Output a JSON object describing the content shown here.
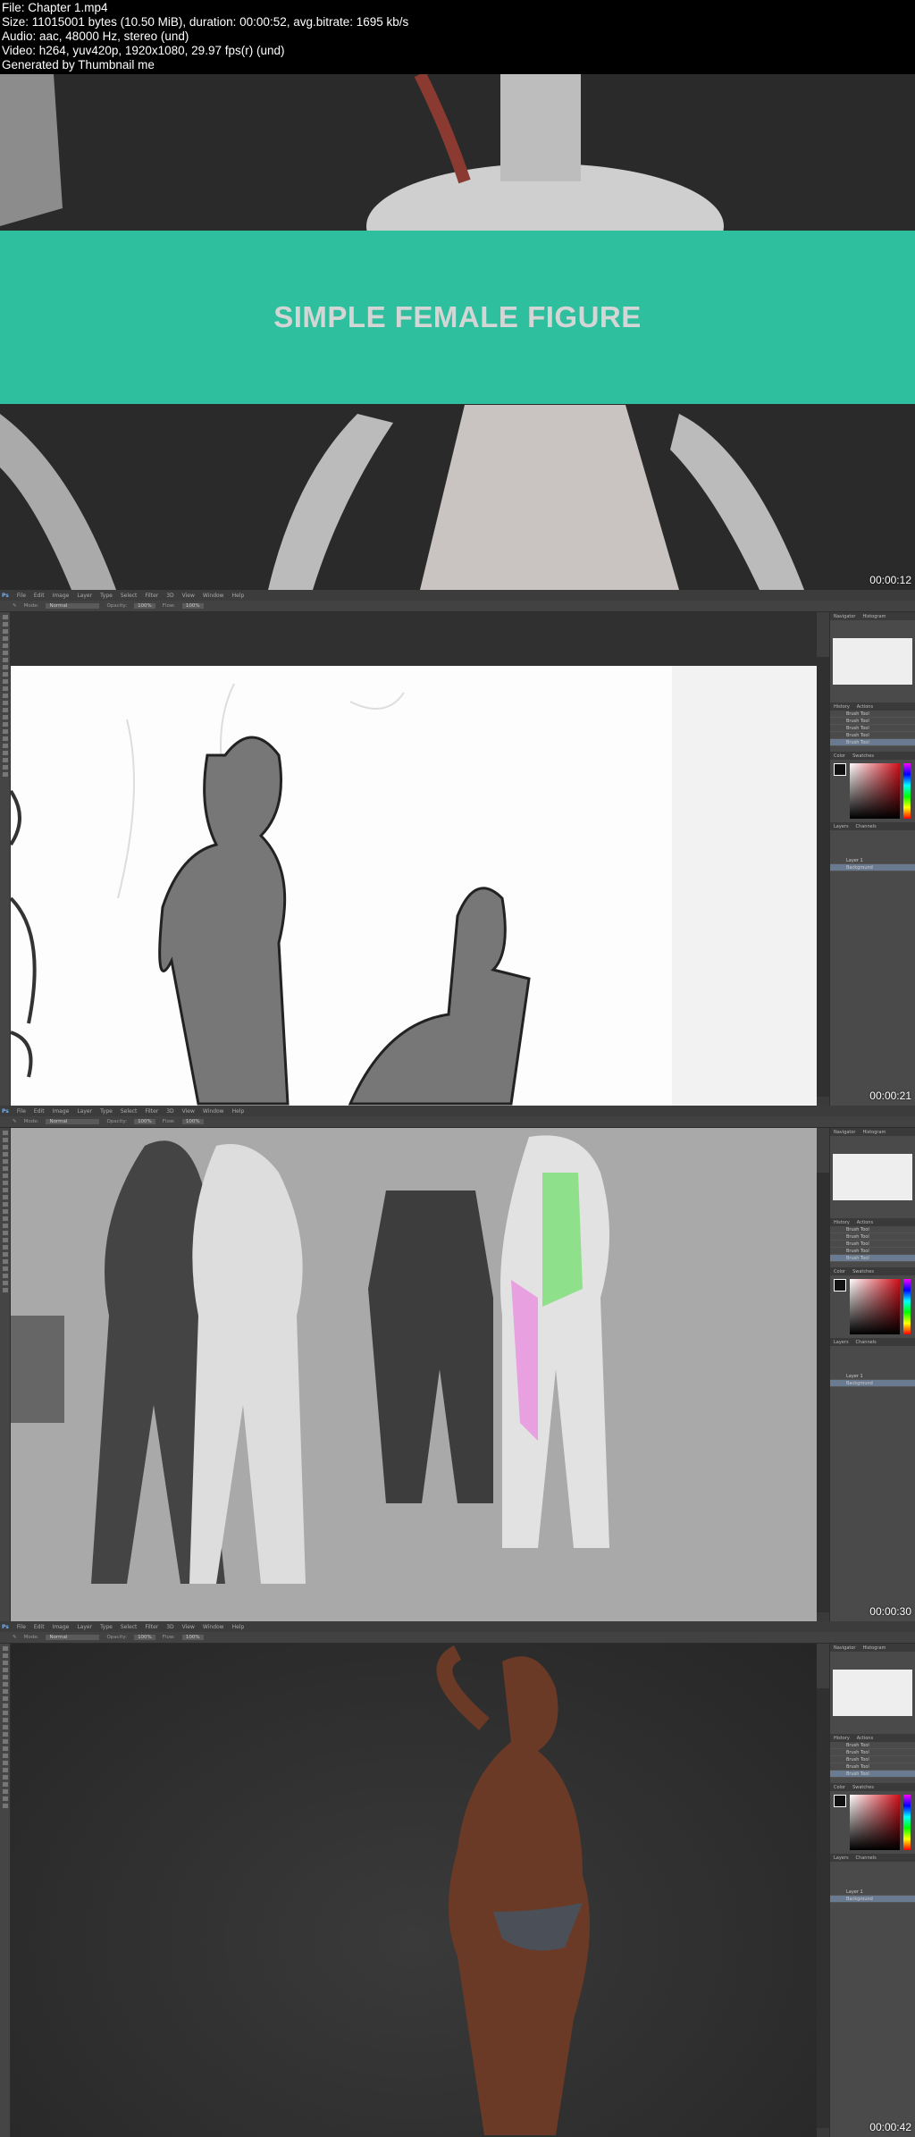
{
  "info": {
    "lines": [
      "File: Chapter 1.mp4",
      "Size: 11015001 bytes (10.50 MiB), duration: 00:00:52, avg.bitrate: 1695 kb/s",
      "Audio: aac, 48000 Hz, stereo (und)",
      "Video: h264, yuv420p, 1920x1080, 29.97 fps(r) (und)",
      "Generated by Thumbnail me"
    ]
  },
  "frames": [
    {
      "timestamp": "00:00:12",
      "title": "SIMPLE FEMALE FIGURE"
    },
    {
      "timestamp": "00:00:21"
    },
    {
      "timestamp": "00:00:30"
    },
    {
      "timestamp": "00:00:42"
    }
  ],
  "ps": {
    "logo": "Ps",
    "menu": [
      "File",
      "Edit",
      "Image",
      "Layer",
      "Type",
      "Select",
      "Filter",
      "3D",
      "View",
      "Window",
      "Help"
    ],
    "options": {
      "mode_label": "Mode:",
      "mode": "Normal",
      "opacity_label": "Opacity:",
      "opacity": "100%",
      "flow_label": "Flow:",
      "flow": "100%"
    },
    "panels": {
      "navigator": "Navigator",
      "histogram": "Histogram",
      "history": "History",
      "actions": "Actions",
      "history_item": "Brush Tool",
      "color": "Color",
      "swatches": "Swatches",
      "layers": "Layers",
      "channels": "Channels",
      "layer1": "Layer 1",
      "background": "Background"
    }
  },
  "colors": {
    "teal": "#2ebf9f"
  }
}
